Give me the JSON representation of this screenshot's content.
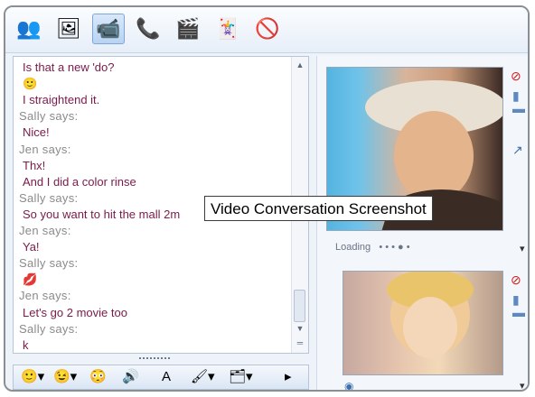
{
  "toolbar": {
    "items": [
      {
        "name": "invite-contact-icon",
        "glyph": "👥"
      },
      {
        "name": "send-file-icon",
        "glyph": "🖼"
      },
      {
        "name": "video-call-icon",
        "glyph": "📹"
      },
      {
        "name": "phone-call-icon",
        "glyph": "📞"
      },
      {
        "name": "activities-icon",
        "glyph": "🎬"
      },
      {
        "name": "games-icon",
        "glyph": "🃏"
      },
      {
        "name": "block-contact-icon",
        "glyph": "🚫"
      }
    ]
  },
  "chat": {
    "lines": [
      {
        "type": "msg",
        "text": "Is that a new 'do?"
      },
      {
        "type": "emoji",
        "text": "🙂"
      },
      {
        "type": "msg",
        "text": "I straightend it."
      },
      {
        "type": "name",
        "text": "Sally says:"
      },
      {
        "type": "msg",
        "text": "Nice!"
      },
      {
        "type": "name",
        "text": "Jen says:"
      },
      {
        "type": "msg",
        "text": "Thx!"
      },
      {
        "type": "msg",
        "text": "And I did a color rinse"
      },
      {
        "type": "name",
        "text": "Sally says:"
      },
      {
        "type": "msg",
        "text": "So you want to hit the mall 2m"
      },
      {
        "type": "name",
        "text": "Jen says:"
      },
      {
        "type": "msg",
        "text": "Ya!"
      },
      {
        "type": "name",
        "text": "Sally says:"
      },
      {
        "type": "emoji",
        "text": "💋"
      },
      {
        "type": "name",
        "text": "Jen says:"
      },
      {
        "type": "msg",
        "text": "Let's go 2 movie too"
      },
      {
        "type": "name",
        "text": "Sally says:"
      },
      {
        "type": "msg",
        "text": "k"
      }
    ]
  },
  "bottombar": {
    "items": [
      {
        "name": "emoticons-icon",
        "glyph": "🙂▾"
      },
      {
        "name": "winks-icon",
        "glyph": "😉▾"
      },
      {
        "name": "nudge-icon",
        "glyph": "😳"
      },
      {
        "name": "voice-clip-icon",
        "glyph": "🔊"
      },
      {
        "name": "font-icon",
        "glyph": "A"
      },
      {
        "name": "handwriting-icon",
        "glyph": "🖌▾"
      },
      {
        "name": "background-icon",
        "glyph": "🗂▾"
      },
      {
        "name": "more-icon",
        "glyph": "▸"
      }
    ]
  },
  "video": {
    "loading_label": "Loading",
    "loading_dots": "• • • ● •",
    "menu_glyph": "▾"
  },
  "tooltip": {
    "text": "Video Conversation Screenshot"
  },
  "colors": {
    "message_text": "#7a1a4a",
    "name_text": "#8a8a8a",
    "stop_red": "#d01a1a"
  }
}
